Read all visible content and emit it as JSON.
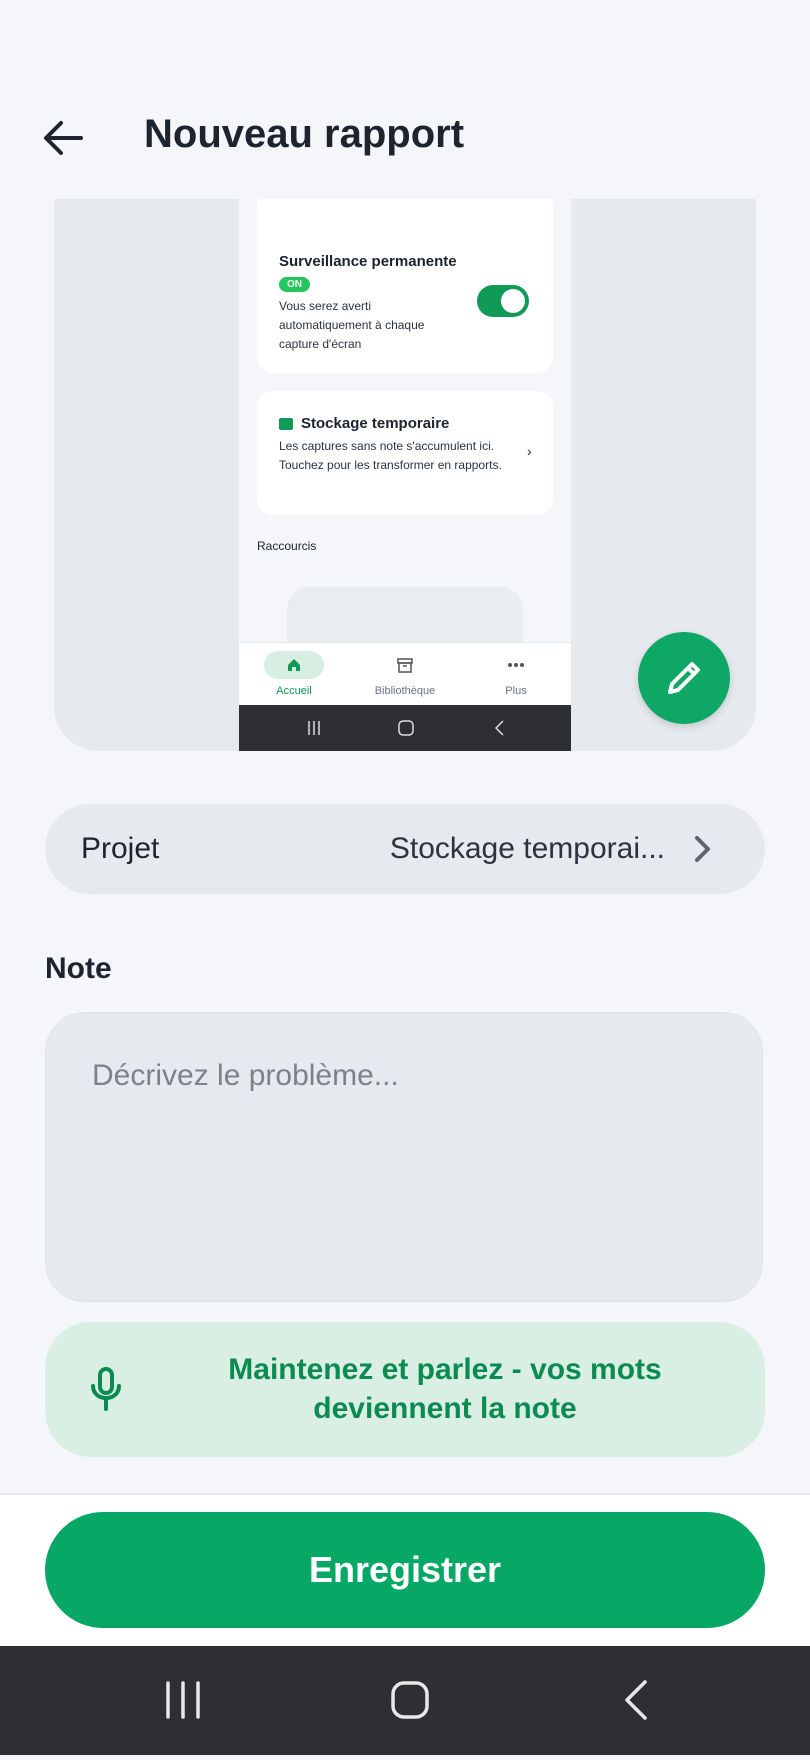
{
  "header": {
    "title": "Nouveau rapport"
  },
  "preview": {
    "monitoring": {
      "title": "Surveillance permanente",
      "badge": "ON",
      "description": "Vous serez averti automatiquement à chaque capture d'écran",
      "toggle_on": true
    },
    "temp_storage": {
      "title": "Stockage temporaire",
      "description": "Les captures sans note s'accumulent ici. Touchez pour les transformer en rapports."
    },
    "shortcuts_label": "Raccourcis",
    "nav": [
      {
        "label": "Accueil",
        "icon": "home-icon",
        "active": true
      },
      {
        "label": "Bibliothèque",
        "icon": "archive-icon",
        "active": false
      },
      {
        "label": "Plus",
        "icon": "more-icon",
        "active": false
      }
    ]
  },
  "project": {
    "label": "Projet",
    "value": "Stockage temporai..."
  },
  "note": {
    "label": "Note",
    "placeholder": "Décrivez le problème...",
    "value": ""
  },
  "voice": {
    "text": "Maintenez et parlez - vos mots deviennent la note"
  },
  "save_button": {
    "label": "Enregistrer"
  },
  "colors": {
    "accent": "#07a765",
    "accent_light": "#d9efe4",
    "background": "#f4f6f9"
  }
}
